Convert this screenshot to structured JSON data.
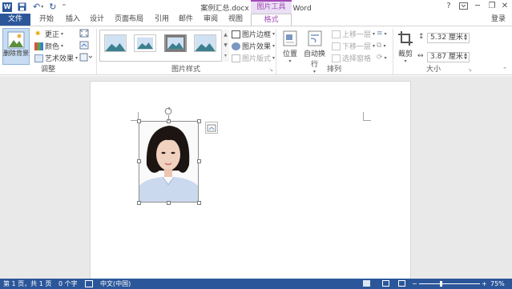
{
  "title_bar": {
    "document_title": "案例汇总.docx [兼容模式] - Word",
    "context_tools_label": "图片工具",
    "help": "?",
    "minimize": "─",
    "restore": "❐",
    "close": "✕",
    "qat_more": "⁼"
  },
  "tabs": {
    "file": "文件",
    "items": [
      "开始",
      "插入",
      "设计",
      "页面布局",
      "引用",
      "邮件",
      "审阅",
      "视图"
    ],
    "format": "格式",
    "login": "登录"
  },
  "ribbon": {
    "adjust": {
      "remove_background": "删除背景",
      "corrections": "更正",
      "color": "颜色",
      "artistic_effects": "艺术效果",
      "label": "调整"
    },
    "picture_styles": {
      "border": "图片边框",
      "effects": "图片效果",
      "layout": "图片版式",
      "label": "图片样式"
    },
    "arrange": {
      "position": "位置",
      "wrap_text": "自动换行",
      "bring_forward": "上移一层",
      "send_backward": "下移一层",
      "selection_pane": "选择窗格",
      "label": "排列"
    },
    "size": {
      "crop": "裁剪",
      "height": "5.32 厘米",
      "width": "3.87 厘米",
      "label": "大小"
    }
  },
  "status_bar": {
    "page": "第 1 页，共 1 页",
    "words": "0 个字",
    "language": "中文(中国)",
    "zoom": "75%"
  },
  "colors": {
    "accent_blue": "#2b579a",
    "context_purple": "#a24ab6",
    "selected_button": "#c8dcf2"
  }
}
